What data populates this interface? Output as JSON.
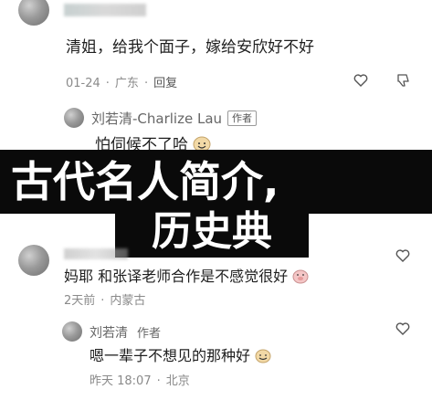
{
  "comments": {
    "c1": {
      "text": "清姐，给我个面子，嫁给安欣好不好",
      "date": "01-24",
      "location": "广东",
      "reply_label": "回复"
    },
    "c1_reply": {
      "author": "刘若清-Charlize Lau",
      "author_badge": "作者",
      "text": "怕伺候不了哈"
    },
    "c2": {
      "text": "妈耶 和张译老师合作是不感觉很好",
      "date": "2天前",
      "location": "内蒙古"
    },
    "c2_reply": {
      "author": "刘若清",
      "author_badge": "作者",
      "text": "嗯一辈子不想见的那种好",
      "date": "昨天 18:07",
      "location": "北京"
    }
  },
  "overlay": {
    "line1": "古代名人简介,",
    "line2": "历史典"
  },
  "icons": [
    "heart-icon",
    "thumb-down-icon",
    "smile-emoji-icon"
  ],
  "colors": {
    "banner_bg": "#0a0a0a",
    "banner_text": "#ffffff",
    "meta": "#8a8a8a"
  }
}
